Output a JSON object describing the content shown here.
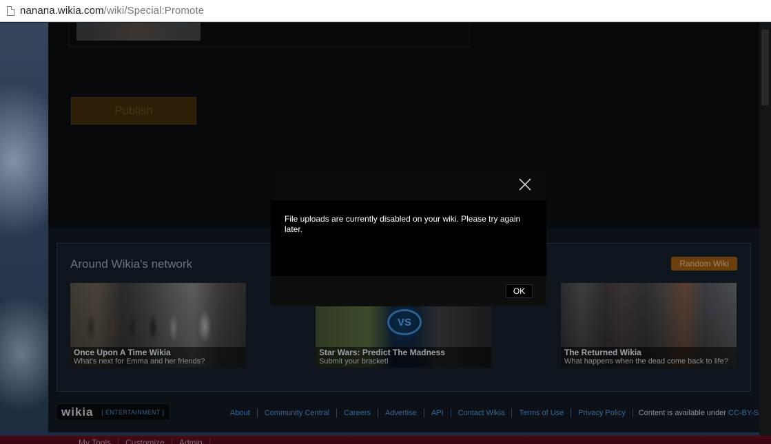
{
  "browser": {
    "url_host": "nanana.wikia.com",
    "url_path": "/wiki/Special:Promote"
  },
  "page": {
    "publish_label": "Publish"
  },
  "network": {
    "title": "Around Wikia's network",
    "random_label": "Random Wiki",
    "cards": [
      {
        "title": "Once Upon A Time Wikia",
        "subtitle": "What's next for Emma and her friends?"
      },
      {
        "title": "Star Wars: Predict The Madness",
        "subtitle": "Submit your bracket!"
      },
      {
        "title": "The Returned Wikia",
        "subtitle": "What happens when the dead come back to life?"
      }
    ],
    "vs_label": "VS"
  },
  "footer": {
    "logo_word": "wikia",
    "logo_tag": "[ ENTERTAINMENT ]",
    "links": [
      "About",
      "Community Central",
      "Careers",
      "Advertise",
      "API",
      "Contact Wikia",
      "Terms of Use",
      "Privacy Policy"
    ],
    "notice_text": "Content is available under ",
    "license_link": "CC-BY-SA",
    "notice_end": "."
  },
  "toolbar": {
    "items": [
      "My Tools",
      "Customize",
      "Admin"
    ]
  },
  "modal": {
    "message": "File uploads are currently disabled on your wiki. Please try again later.",
    "ok_label": "OK",
    "close_icon": "close-icon"
  }
}
